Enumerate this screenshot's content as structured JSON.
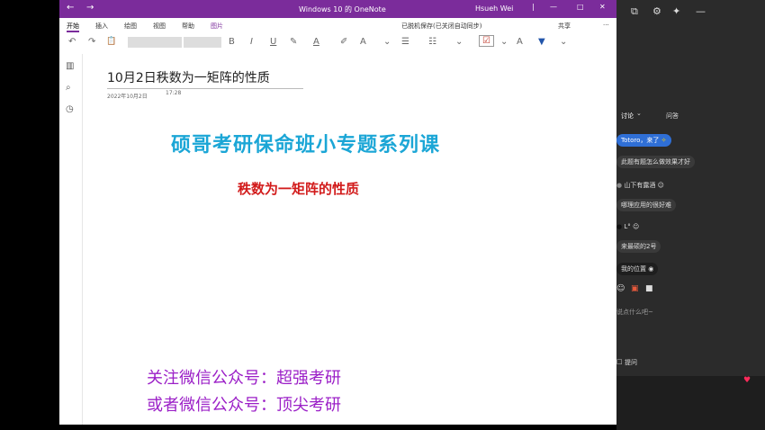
{
  "window": {
    "title": "Windows 10 的 OneNote",
    "user": "Hsueh Wei",
    "nav_back": "←",
    "nav_forward": "→",
    "minimize": "—",
    "maximize": "□",
    "close": "✕",
    "separator": "|"
  },
  "menu": {
    "tabs": [
      "开始",
      "插入",
      "绘图",
      "视图",
      "帮助",
      "图片"
    ],
    "status": "已脱机保存(已关闭自动同步)",
    "share": "共享",
    "more": "···"
  },
  "toolbar": {
    "undo": "↶",
    "redo": "↷",
    "clipboard": "📋",
    "bold": "B",
    "italic": "I",
    "underline": "U",
    "highlight": "✎",
    "font_color": "A",
    "clear": "✐",
    "styles": "A",
    "bullets": "☰",
    "numbered": "☷",
    "todo": "☑",
    "tag_dropdown": "⌄",
    "pen": "A",
    "mark": "▼",
    "dropdown": "⌄"
  },
  "rail": {
    "notebooks": "▥",
    "search": "⌕",
    "recent": "◷"
  },
  "page": {
    "title": "10月2日秩数为一矩阵的性质",
    "date": "2022年10月2日",
    "time": "17:28",
    "heading": "硕哥考研保命班小专题系列课",
    "subheading": "秩数为一矩阵的性质",
    "footer_line1": "关注微信公众号：超强考研",
    "footer_line2": "或者微信公众号：顶尖考研",
    "colors": {
      "heading": "#1ba6d6",
      "subheading": "#d21b1b",
      "footer": "#9b1fc7"
    }
  },
  "side_panel": {
    "tabs": [
      "讨论",
      "问答"
    ],
    "icons": {
      "edit": "⧉",
      "settings": "⚙",
      "pin": "✦",
      "dash": "—",
      "dropdown": "⌄",
      "location": "◉",
      "smile": "☺",
      "gift": "▣",
      "folder": "■",
      "face": "☺",
      "sparkle": "✧",
      "checkbox": "□",
      "heart": "♥",
      "avatar": "●"
    },
    "messages": [
      "Totoro，来了",
      "此题有题怎么做效果才好",
      "山下有露酒",
      "哪理应用的很好难",
      "L°",
      "来最硕的2号",
      "我的位置",
      "说点什么吧~",
      "提问"
    ]
  }
}
